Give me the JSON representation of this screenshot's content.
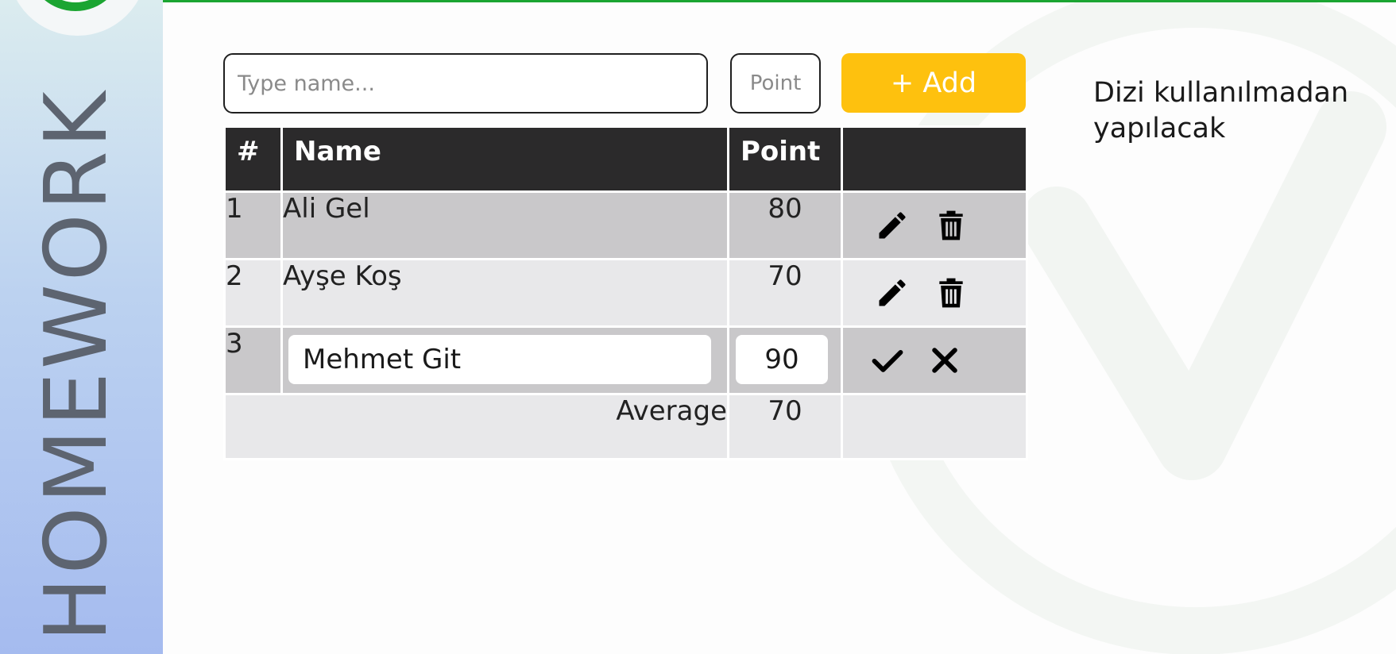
{
  "colors": {
    "accent_green": "#1ba532",
    "add_button": "#fec10e",
    "header_bg": "#2b2a2b",
    "row_dark": "#c9c8ca",
    "row_light": "#e8e8ea"
  },
  "sidebar": {
    "title": "HOMEWORK"
  },
  "form": {
    "name_placeholder": "Type name...",
    "name_value": "",
    "point_placeholder": "Point",
    "point_value": "",
    "add_label": "+ Add"
  },
  "table": {
    "headers": {
      "num": "#",
      "name": "Name",
      "point": "Point",
      "actions": ""
    },
    "rows": [
      {
        "num": "1",
        "name": "Ali Gel",
        "point": "80",
        "actions": [
          "pencil-icon",
          "trash-icon"
        ]
      },
      {
        "num": "2",
        "name": "Ayşe Koş",
        "point": "70",
        "actions": [
          "pencil-icon",
          "trash-icon"
        ]
      }
    ],
    "editing_row": {
      "num": "3",
      "name_value": "Mehmet Git",
      "point_value": "90",
      "actions": [
        "check-icon",
        "close-icon"
      ]
    },
    "footer": {
      "label": "Average",
      "value": "70"
    }
  },
  "note": {
    "line1": "Dizi kullanılmadan",
    "line2": "yapılacak"
  }
}
